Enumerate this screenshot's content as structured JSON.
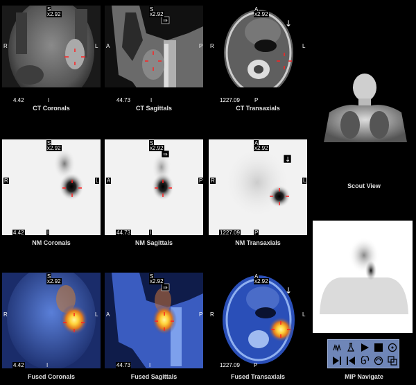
{
  "views": {
    "ct_coronal": {
      "label": "CT Coronals",
      "top": "S",
      "zoom": "x2.92",
      "left": "R",
      "right": "L",
      "bottom": "I",
      "coord": "4.42"
    },
    "ct_sagittal": {
      "label": "CT Sagittals",
      "top": "S",
      "zoom": "x2.92",
      "left": "A",
      "right": "P",
      "bottom": "I",
      "coord": "44.73"
    },
    "ct_trans": {
      "label": "CT Transaxials",
      "top": "A",
      "zoom": "x2.92",
      "left": "R",
      "right": "L",
      "bottom": "P",
      "coord": "1227.09"
    },
    "nm_coronal": {
      "label": "NM Coronals",
      "top": "S",
      "zoom": "x2.92",
      "left": "R",
      "right": "L",
      "bottom": "I",
      "coord": "4.42"
    },
    "nm_sagittal": {
      "label": "NM Sagittals",
      "top": "S",
      "zoom": "x2.92",
      "left": "A",
      "right": "P",
      "bottom": "I",
      "coord": "44.73"
    },
    "nm_trans": {
      "label": "NM Transaxials",
      "top": "A",
      "zoom": "x2.92",
      "left": "R",
      "right": "L",
      "bottom": "P",
      "coord": "1227.09"
    },
    "fu_coronal": {
      "label": "Fused Coronals",
      "top": "S",
      "zoom": "x2.92",
      "left": "R",
      "right": "L",
      "bottom": "I",
      "coord": "4.42"
    },
    "fu_sagittal": {
      "label": "Fused Sagittals",
      "top": "S",
      "zoom": "x2.92",
      "left": "A",
      "right": "P",
      "bottom": "I",
      "coord": "44.73"
    },
    "fu_trans": {
      "label": "Fused Transaxials",
      "top": "A",
      "zoom": "x2.92",
      "left": "R",
      "right": "L",
      "bottom": "P",
      "coord": "1227.09"
    }
  },
  "scout_label": "Scout View",
  "mip_label": "MIP Navigate",
  "toolbar": {
    "row1": [
      "pan-icon",
      "flask-icon",
      "play-icon",
      "stop-icon",
      "target-icon"
    ],
    "row2": [
      "step-back-icon",
      "rewind-icon",
      "spiral-icon",
      "swirl-icon",
      "frames-icon"
    ]
  },
  "colors": {
    "crosshair": "#ff2020",
    "label": "#e0e0e0",
    "toolbar": "#6f86b8",
    "fused_base": "#2a4fb8",
    "hotspot": "#ffd23a"
  }
}
